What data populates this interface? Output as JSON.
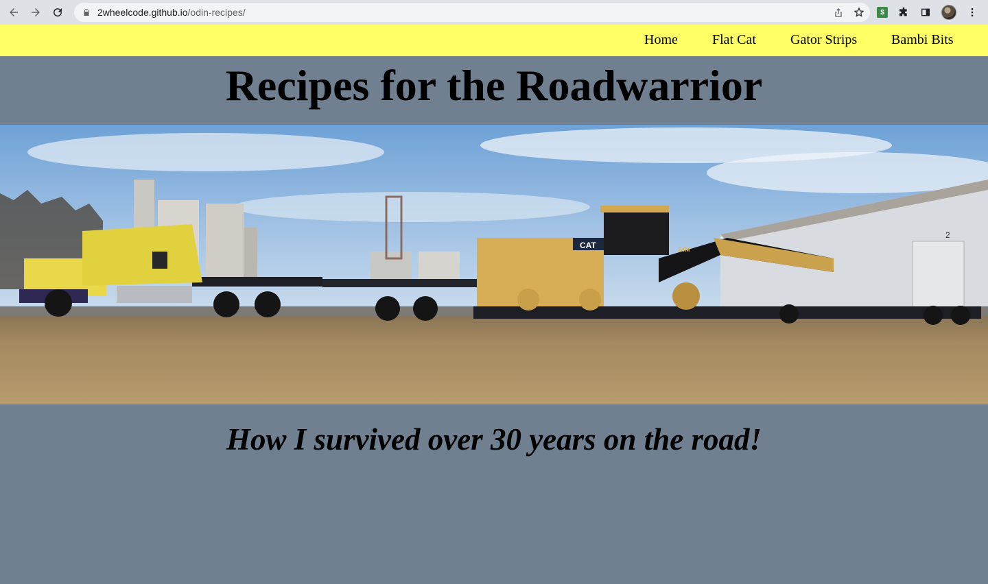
{
  "browser": {
    "url_host": "2wheelcode.github.io",
    "url_path": "/odin-recipes/",
    "extension_badge": "$"
  },
  "nav": {
    "links": [
      "Home",
      "Flat Cat",
      "Gator Strips",
      "Bambi Bits"
    ]
  },
  "page": {
    "title": "Recipes for the Roadwarrior",
    "subtitle": "How I survived over 30 years on the road!"
  },
  "hero": {
    "truck_sign": "CAT",
    "machine_label": "24M",
    "door_number": "2"
  },
  "colors": {
    "background": "#708090",
    "nav_background": "#ffff66"
  },
  "icons": [
    "back-icon",
    "forward-icon",
    "reload-icon",
    "lock-icon",
    "share-icon",
    "star-icon",
    "extensions-icon",
    "sidepanel-icon",
    "menu-icon"
  ]
}
